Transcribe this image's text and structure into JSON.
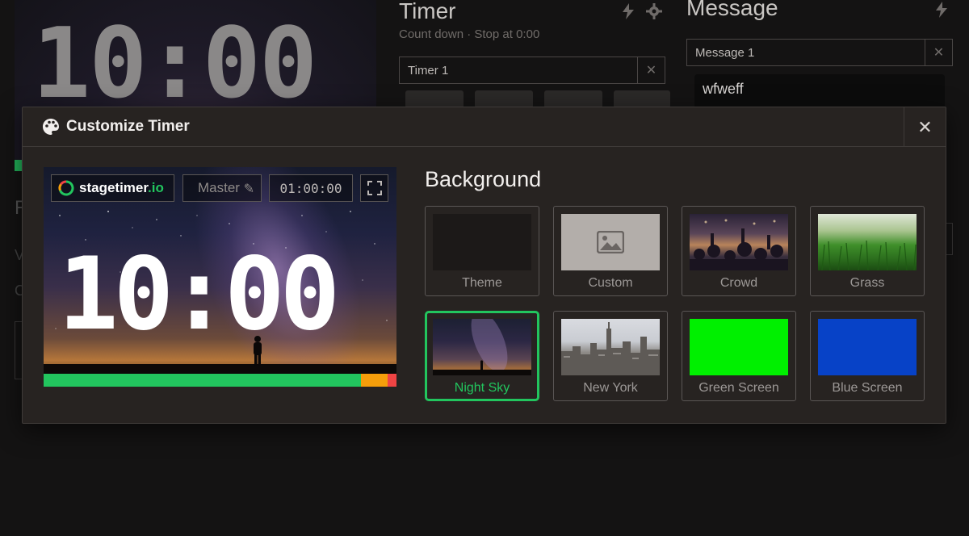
{
  "background_app": {
    "big_clock": "10:00",
    "fragment_r": "R",
    "fragment_v": "V",
    "fragment_c": "C",
    "timer": {
      "title": "Timer",
      "subtitle": "Count down · Stop at 0:00",
      "row_name": "Timer 1",
      "close_label": "✕"
    },
    "message": {
      "title": "Message",
      "row_name": "Message 1",
      "text": "wfweff",
      "close_label": "✕"
    }
  },
  "modal": {
    "title": "Customize Timer",
    "close_label": "✕",
    "preview": {
      "logo_text": "stagetimer",
      "logo_suffix": ".io",
      "timer_name": "Master",
      "clock": "01:00:00",
      "big_time": "10:00",
      "progress": {
        "green_fraction": 0.9,
        "orange_fraction": 0.075,
        "red_fraction": 0.025
      }
    },
    "background_section": {
      "heading": "Background",
      "options": [
        {
          "label": "Theme",
          "selected": false
        },
        {
          "label": "Custom",
          "selected": false
        },
        {
          "label": "Crowd",
          "selected": false
        },
        {
          "label": "Grass",
          "selected": false
        },
        {
          "label": "Night Sky",
          "selected": true
        },
        {
          "label": "New York",
          "selected": false
        },
        {
          "label": "Green Screen",
          "selected": false
        },
        {
          "label": "Blue Screen",
          "selected": false
        }
      ]
    }
  },
  "colors": {
    "accent": "#22c55e",
    "warning": "#f59e0b",
    "danger": "#ef4444",
    "green_screen": "#00f000",
    "blue_screen": "#0742c7",
    "modal_bg": "#272321",
    "page_bg": "#141313"
  },
  "icons": {
    "header": "palette-icon",
    "close": "close-icon",
    "custom": "image-icon",
    "fullscreen": "fullscreen-icon",
    "edit": "pencil-icon",
    "flash": "lightning-icon",
    "settings": "gear-icon"
  }
}
